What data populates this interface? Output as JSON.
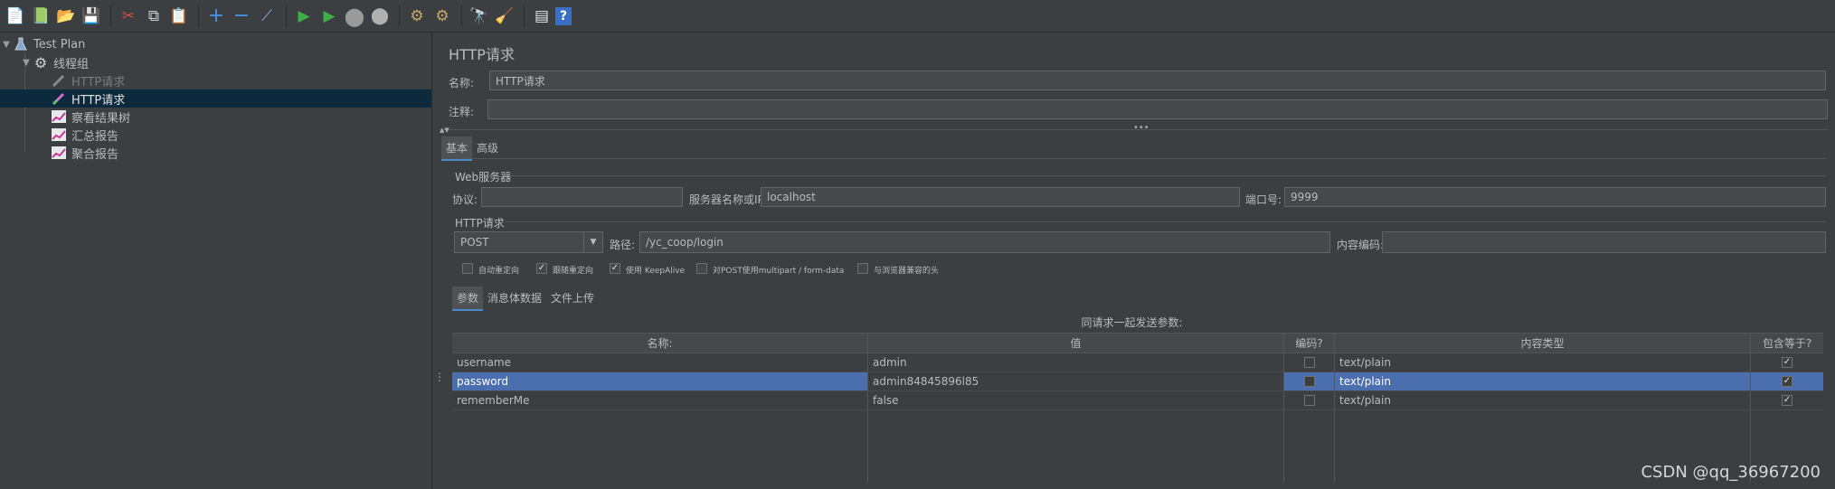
{
  "toolbar": {
    "buttons": [
      {
        "icon": "new-icon",
        "glyph": "📄"
      },
      {
        "icon": "templates-icon",
        "glyph": "📗"
      },
      {
        "icon": "open-icon",
        "glyph": "📂"
      },
      {
        "icon": "save-icon",
        "glyph": "💾"
      },
      {
        "icon": "cut-icon",
        "glyph": "✂"
      },
      {
        "icon": "copy-icon",
        "glyph": "⧉"
      },
      {
        "icon": "paste-icon",
        "glyph": "📋"
      },
      {
        "icon": "expand-icon",
        "glyph": "+"
      },
      {
        "icon": "collapse-icon",
        "glyph": "−"
      },
      {
        "icon": "toggle-icon",
        "glyph": "⟋"
      },
      {
        "icon": "start-icon",
        "glyph": "▶"
      },
      {
        "icon": "start-no-pause-icon",
        "glyph": "▶"
      },
      {
        "icon": "stop-icon",
        "glyph": "⬤"
      },
      {
        "icon": "shutdown-icon",
        "glyph": "⬤"
      },
      {
        "icon": "clear-icon",
        "glyph": "⚙"
      },
      {
        "icon": "clear-all-icon",
        "glyph": "⚙"
      },
      {
        "icon": "search-icon",
        "glyph": "🔭"
      },
      {
        "icon": "reset-search-icon",
        "glyph": "🧹"
      },
      {
        "icon": "function-helper-icon",
        "glyph": "▤"
      },
      {
        "icon": "help-icon",
        "glyph": "?"
      }
    ]
  },
  "tree": {
    "items": [
      {
        "label": "Test Plan",
        "icon": "flask-icon"
      },
      {
        "label": "线程组",
        "icon": "gear-icon"
      },
      {
        "label": "HTTP请求",
        "icon": "pipette-icon",
        "disabled": true
      },
      {
        "label": "HTTP请求",
        "icon": "pipette-icon",
        "selected": true
      },
      {
        "label": "察看结果树",
        "icon": "chart-icon"
      },
      {
        "label": "汇总报告",
        "icon": "chart-icon"
      },
      {
        "label": "聚合报告",
        "icon": "chart-icon"
      }
    ]
  },
  "panel": {
    "title": "HTTP请求",
    "name_label": "名称:",
    "name_value": "HTTP请求",
    "comment_label": "注释:",
    "comment_value": "",
    "tabs": [
      "基本",
      "高级"
    ],
    "web_server": {
      "section": "Web服务器",
      "protocol_label": "协议:",
      "protocol_value": "",
      "server_label": "服务器名称或IP:",
      "server_value": "localhost",
      "port_label": "端口号:",
      "port_value": "9999"
    },
    "http_request": {
      "section": "HTTP请求",
      "method": "POST",
      "path_label": "路径:",
      "path_value": "/yc_coop/login",
      "encoding_label": "内容编码:",
      "encoding_value": ""
    },
    "options": [
      {
        "label": "自动重定向",
        "checked": false
      },
      {
        "label": "跟随重定向",
        "checked": true
      },
      {
        "label": "使用 KeepAlive",
        "checked": true
      },
      {
        "label": "对POST使用multipart / form-data",
        "checked": false
      },
      {
        "label": "与浏览器兼容的头",
        "checked": false
      }
    ],
    "subtabs": [
      "参数",
      "消息体数据",
      "文件上传"
    ],
    "params_caption": "同请求一起发送参数:",
    "table": {
      "headers": [
        "名称:",
        "值",
        "编码?",
        "内容类型",
        "包含等于?"
      ],
      "rows": [
        {
          "name": "username",
          "value": "admin",
          "encode": false,
          "content_type": "text/plain",
          "include_equals": true
        },
        {
          "name": "password",
          "value": "admin84845896l85",
          "encode": false,
          "content_type": "text/plain",
          "include_equals": true,
          "selected": true
        },
        {
          "name": "rememberMe",
          "value": "false",
          "encode": false,
          "content_type": "text/plain",
          "include_equals": true
        }
      ]
    }
  },
  "watermark": "CSDN @qq_36967200",
  "check_glyph": "✓",
  "colors": {
    "background": "#3c3f41",
    "selection": "#4b6eaf",
    "tree_selection": "#0d293e",
    "tab_accent": "#4a88c7"
  }
}
